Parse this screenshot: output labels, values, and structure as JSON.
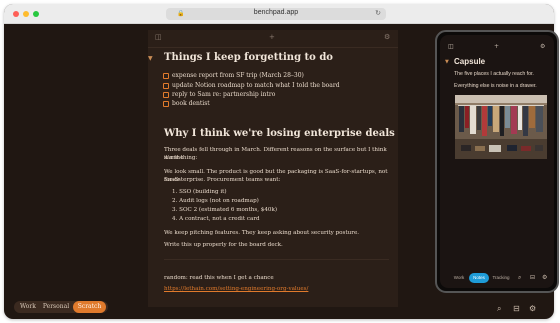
{
  "browser": {
    "url": "benchpad.app"
  },
  "editor": {
    "section1": {
      "heading": "Things I keep forgetting to do",
      "todos": [
        "expense report from SF trip (March 28–30)",
        "update Notion roadmap to match what I told the board",
        "reply to Sam re: partnership intro",
        "book dentist"
      ]
    },
    "section2": {
      "heading": "Why I think we're losing enterprise deals",
      "p1_line1": "Three deals fell through in March. Different reasons on the surface but I think it's the",
      "p1_line2": "same thing:",
      "p2_line1": "We look small. The product is good but the packaging is SaaS-for-startups, not SaaS-",
      "p2_line2": "for-enterprise. Procurement teams want:",
      "list": [
        "1.  SSO (building it)",
        "2.  Audit logs (not on roadmap)",
        "3.  SOC 2 (estimated 6 months, $40k)",
        "4.  A contract, not a credit card"
      ],
      "p3": "We keep pitching features. They keep asking about security posture.",
      "p4": "Write this up properly for the board deck."
    },
    "random": {
      "text": "random: read this when I get a chance",
      "link": "https://lethain.com/setting-engineering-org-values/"
    }
  },
  "bottom_tabs": [
    "Work",
    "Personal",
    "Scratch"
  ],
  "bottom_tabs_active": "Scratch",
  "phone": {
    "title": "Capsule",
    "line1": "The five places I actually reach for.",
    "line2": "Everything else is noise in a drawer.",
    "tabs": [
      "Work",
      "Notes",
      "Tracking"
    ],
    "tabs_active": "Notes"
  },
  "icons": {
    "sidebar": "sidebar-icon",
    "add": "plus-icon",
    "settings": "gear-icon",
    "search": "search-icon",
    "archive": "archive-icon"
  },
  "colors": {
    "accent": "#e07a2c",
    "background": "#201712",
    "editor_bg": "#2b1f18",
    "phone_accent": "#1e9bd7"
  }
}
